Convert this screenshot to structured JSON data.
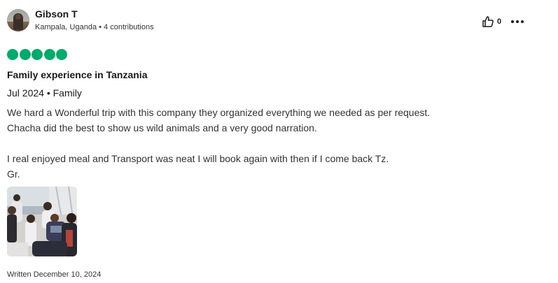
{
  "reviewer": {
    "name": "Gibson T",
    "location": "Kampala, Uganda",
    "separator": "•",
    "contributions": "4 contributions"
  },
  "actions": {
    "helpful_icon": "thumbs-up-icon",
    "helpful_count": "0",
    "more_icon": "more-options-icon"
  },
  "rating": {
    "value": 5,
    "max": 5,
    "color": "#00aa6c"
  },
  "review": {
    "title": "Family experience in Tanzania",
    "trip_date": "Jul 2024",
    "trip_separator": "•",
    "trip_type": "Family",
    "body": [
      "We hard a Wonderful trip with this company they organized everything we needed as per request.",
      "Chacha did the best to show us wild animals and a very good narration.",
      "",
      "I real enjoyed meal and Transport was neat I will book again with then if I come back Tz.",
      "Gr."
    ],
    "photo_count": 1,
    "written": "Written December 10, 2024"
  }
}
